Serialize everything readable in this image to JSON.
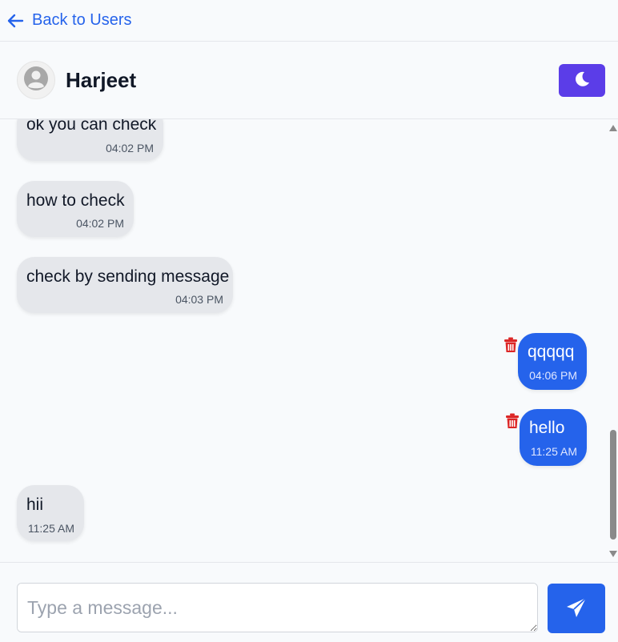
{
  "nav": {
    "back_label": "Back to Users"
  },
  "header": {
    "contact_name": "Harjeet",
    "theme_toggle_icon": "moon-icon"
  },
  "messages": [
    {
      "direction": "received",
      "text": "ok you can check",
      "time": "04:02 PM"
    },
    {
      "direction": "received",
      "text": "how to check",
      "time": "04:02 PM"
    },
    {
      "direction": "received",
      "text": "check by sending message",
      "time": "04:03 PM"
    },
    {
      "direction": "sent",
      "text": "qqqqq",
      "time": "04:06 PM",
      "deletable": true
    },
    {
      "direction": "sent",
      "text": "hello",
      "time": "11:25 AM",
      "deletable": true
    },
    {
      "direction": "received",
      "text": "hii",
      "time": "11:25 AM"
    }
  ],
  "composer": {
    "placeholder": "Type a message...",
    "value": "",
    "send_icon": "paper-plane-icon"
  },
  "colors": {
    "accent": "#2563eb",
    "theme_button": "#5b3de8",
    "received_bubble": "#e5e7eb",
    "delete_icon": "#dc2626"
  }
}
